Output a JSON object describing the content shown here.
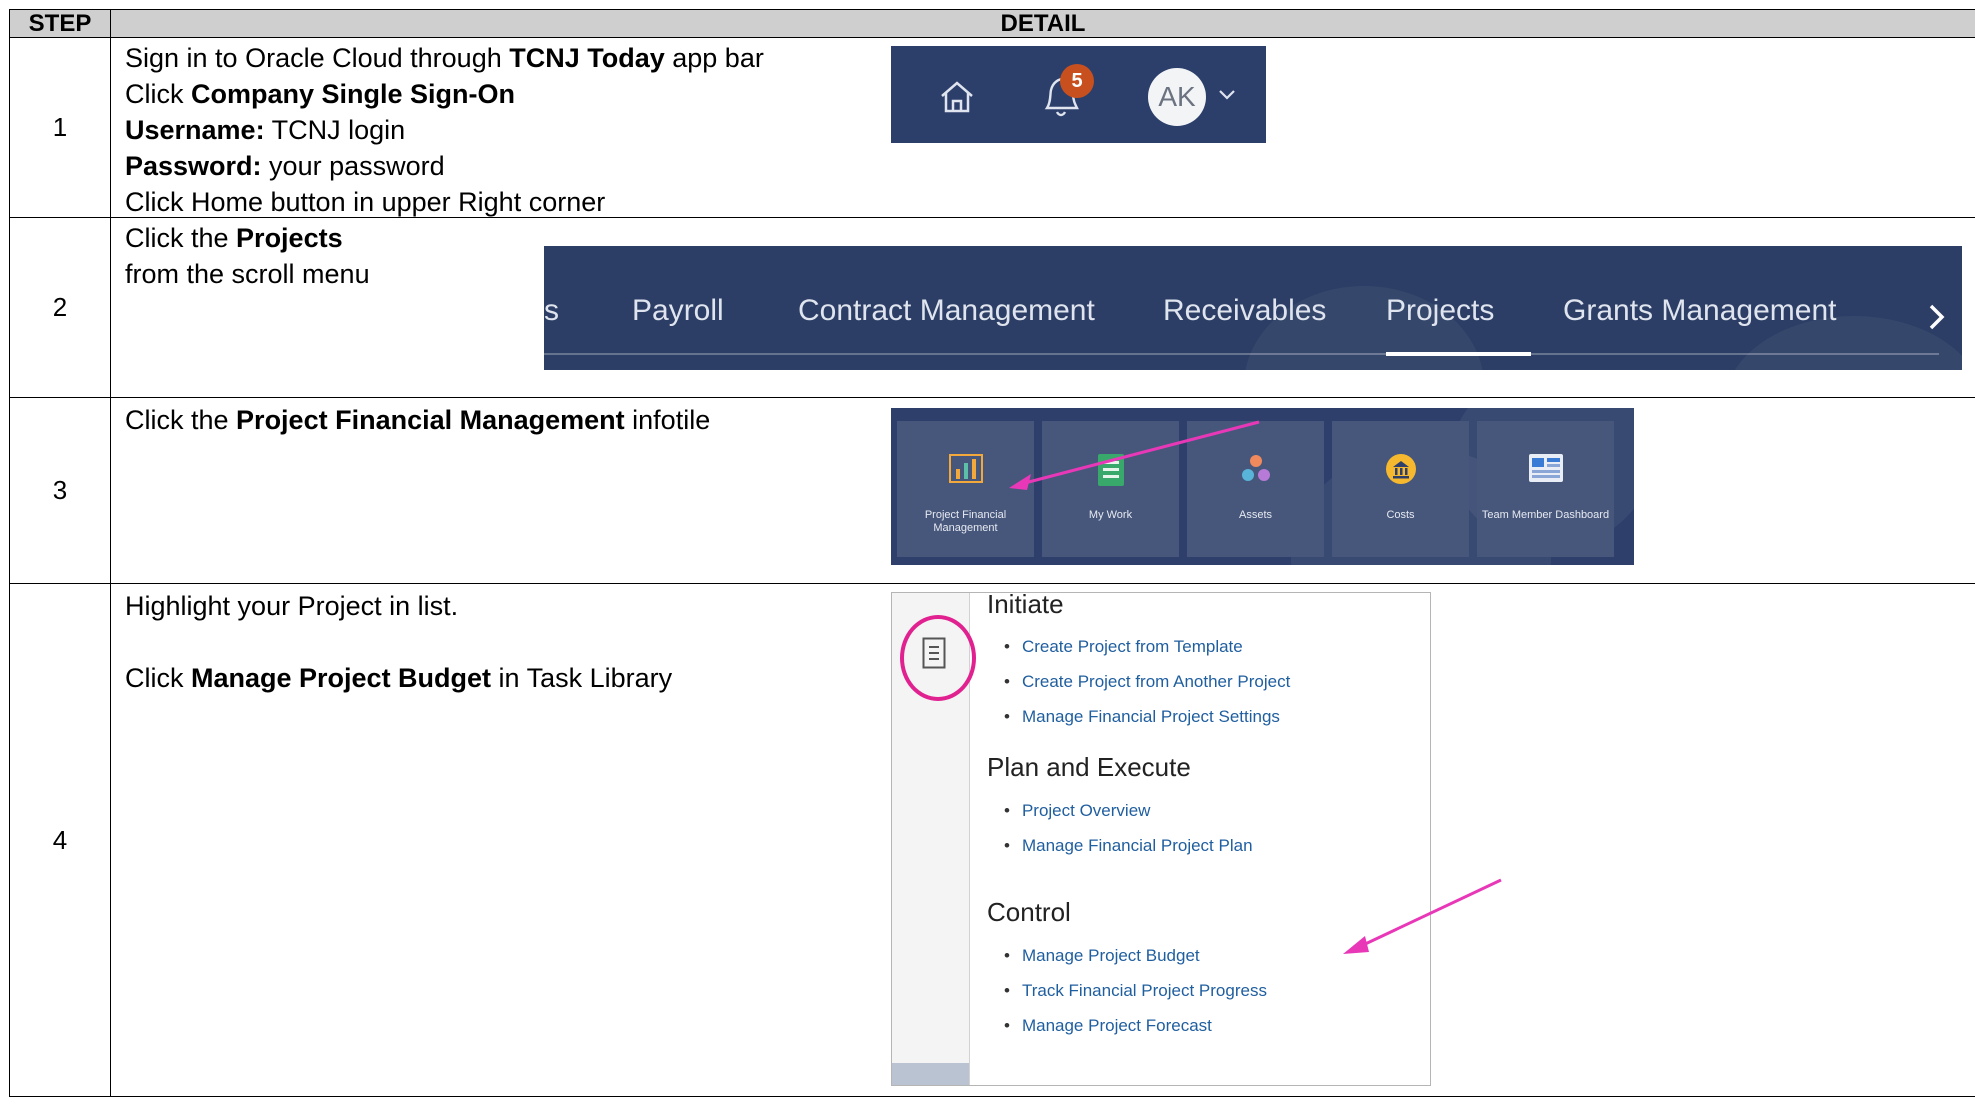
{
  "table": {
    "header_step": "STEP",
    "header_detail": "DETAIL"
  },
  "rows": [
    {
      "num": "1",
      "lines": [
        {
          "pre": "Sign in to Oracle Cloud through ",
          "bold": "TCNJ Today",
          "post": " app bar"
        },
        {
          "pre": "Click ",
          "bold": "Company Single Sign-On",
          "post": ""
        },
        {
          "pre": "",
          "bold": "Username:",
          "post": " TCNJ login"
        },
        {
          "pre": "",
          "bold": "Password:",
          "post": " your password"
        },
        {
          "pre": "Click Home button in upper Right corner",
          "bold": "",
          "post": ""
        }
      ],
      "header_bar": {
        "notification_count": "5",
        "avatar_initials": "AK"
      }
    },
    {
      "num": "2",
      "lines": [
        {
          "pre": "Click the ",
          "bold": "Projects",
          "post": ""
        },
        {
          "pre": "from the scroll menu",
          "bold": "",
          "post": ""
        }
      ],
      "nav": {
        "clipped": "s",
        "items": [
          "Payroll",
          "Contract Management",
          "Receivables",
          "Projects",
          "Grants Management"
        ],
        "active": "Projects"
      }
    },
    {
      "num": "3",
      "lines": [
        {
          "pre": "Click the ",
          "bold": "Project Financial Management",
          "post": " infotile"
        }
      ],
      "tiles": [
        {
          "label": "Project Financial Management",
          "icon": "chart-icon"
        },
        {
          "label": "My Work",
          "icon": "checklist-icon"
        },
        {
          "label": "Assets",
          "icon": "assets-icon"
        },
        {
          "label": "Costs",
          "icon": "bank-icon"
        },
        {
          "label": "Team Member Dashboard",
          "icon": "dashboard-icon"
        }
      ]
    },
    {
      "num": "4",
      "lines": [
        {
          "pre": "Highlight your Project in list.",
          "bold": "",
          "post": ""
        },
        {
          "pre": "",
          "bold": "",
          "post": ""
        },
        {
          "pre": "Click ",
          "bold": "Manage Project Budget",
          "post": " in Task Library"
        }
      ],
      "task_panel": {
        "sections": [
          {
            "title": "Initiate",
            "links": [
              "Create Project from Template",
              "Create Project from Another Project",
              "Manage Financial Project Settings"
            ]
          },
          {
            "title": "Plan and Execute",
            "links": [
              "Project Overview",
              "Manage Financial Project Plan"
            ]
          },
          {
            "title": "Control",
            "links": [
              "Manage Project Budget",
              "Track Financial Project Progress",
              "Manage Project Forecast"
            ]
          }
        ]
      }
    }
  ],
  "colors": {
    "header_bar_bg": "#2c3f6b",
    "notification_badge": "#c8501e",
    "highlight_pink": "#e0218f",
    "link_blue": "#1f5e9f"
  }
}
